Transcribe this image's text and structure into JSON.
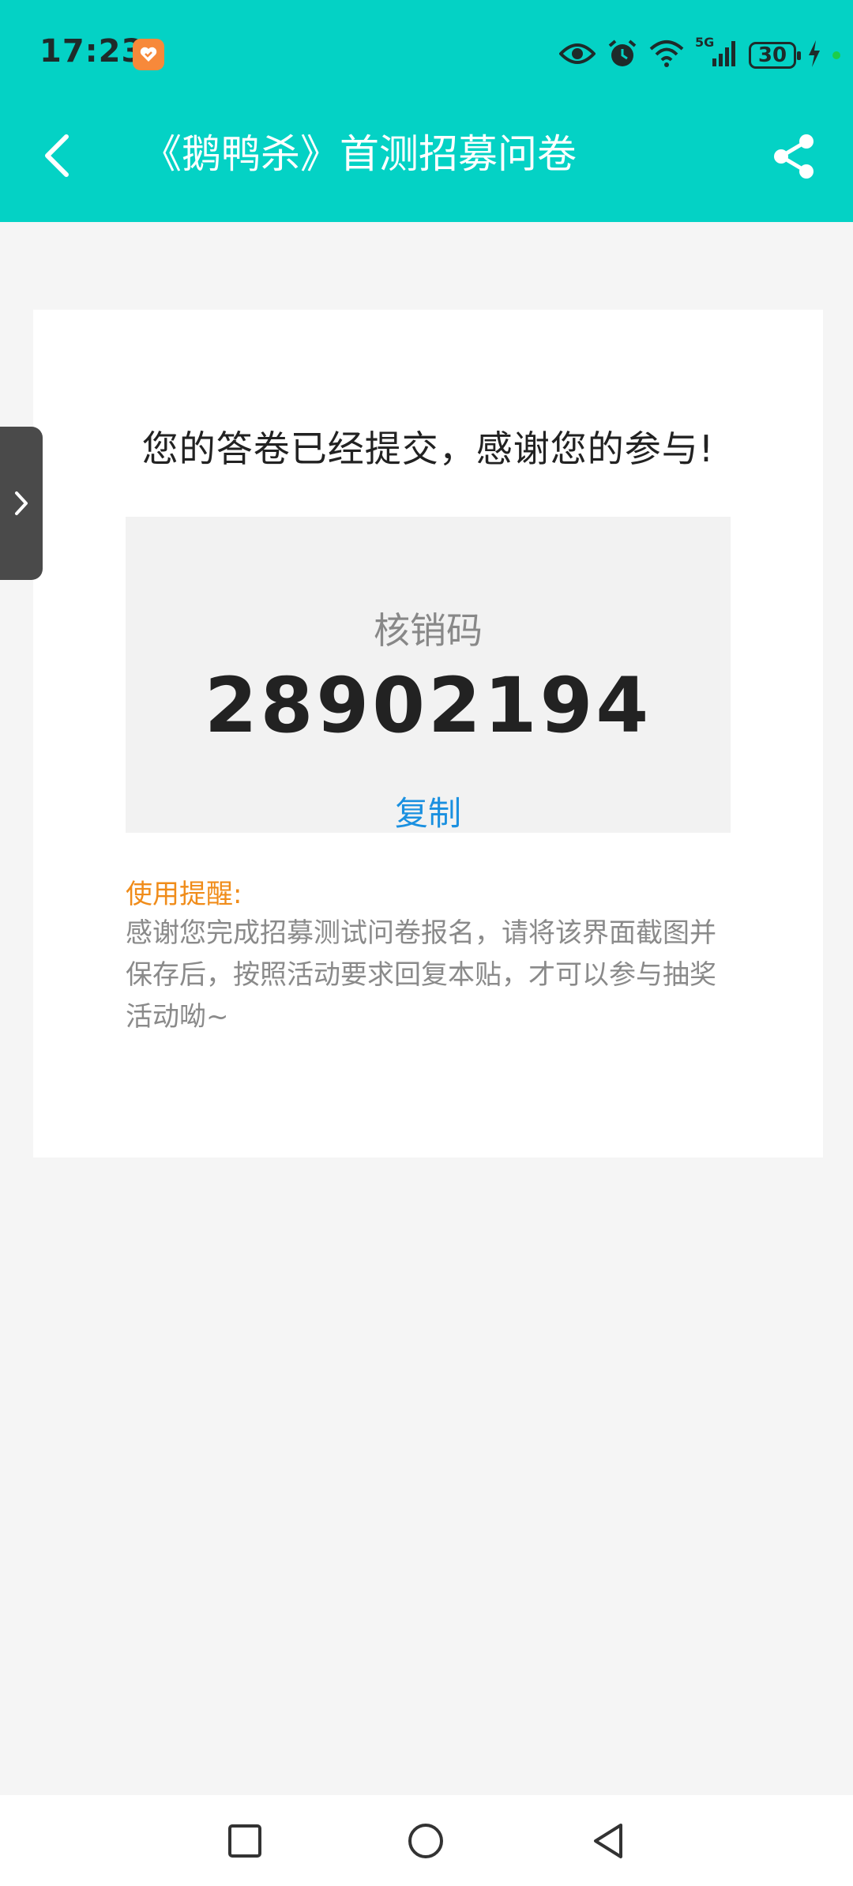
{
  "status_bar": {
    "time": "17:23",
    "battery": "30",
    "network": "5G"
  },
  "header": {
    "title": "《鹅鸭杀》首测招募问卷",
    "background_color": "#04d2c5"
  },
  "result": {
    "thanks_message": "您的答卷已经提交，感谢您的参与!",
    "code_label": "核销码",
    "code_value": "28902194",
    "copy_label": "复制",
    "tip_title": "使用提醒:",
    "tip_body": "感谢您完成招募测试问卷报名，请将该界面截图并保存后，按照活动要求回复本贴，才可以参与抽奖活动呦~"
  },
  "icons": {
    "back": "chevron-left-icon",
    "share": "share-icon",
    "side_handle": "chevron-right-icon",
    "nav_recent": "square-icon",
    "nav_home": "circle-icon",
    "nav_back": "triangle-back-icon"
  },
  "colors": {
    "accent": "#04d2c5",
    "link": "#1a90e0",
    "warning": "#f08c1a"
  }
}
